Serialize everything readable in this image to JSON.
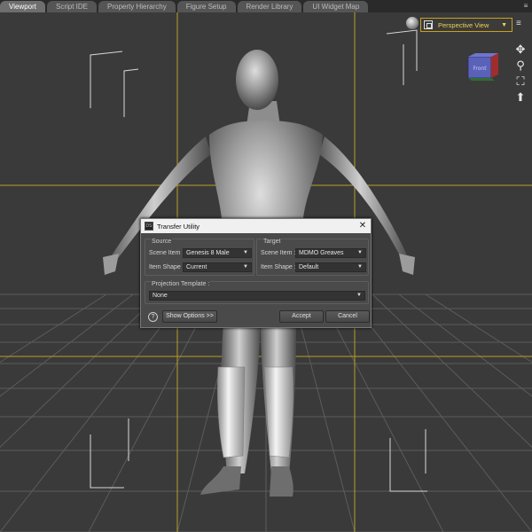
{
  "tabs": [
    {
      "label": "Viewport",
      "active": true
    },
    {
      "label": "Script IDE",
      "active": false
    },
    {
      "label": "Property Hierarchy",
      "active": false
    },
    {
      "label": "Figure Setup",
      "active": false
    },
    {
      "label": "Render Library",
      "active": false
    },
    {
      "label": "UI Widget Map",
      "active": false
    }
  ],
  "tab_menu_icon": "panel-menu-icon",
  "view_controls": {
    "view_selector": "Perspective View",
    "view_selector_icon": "camera-frame-icon",
    "lamp_icon": "lamp-icon",
    "viewcube_label": "Front",
    "nav_icons": [
      "pan-icon",
      "zoom-icon",
      "frame-icon",
      "orbit-icon"
    ]
  },
  "dialog": {
    "title": "Transfer Utility",
    "close_glyph": "✕",
    "source": {
      "label": "Source",
      "scene_item_label": "Scene Item :",
      "scene_item_value": "Genesis 8 Male",
      "item_shape_label": "Item Shape :",
      "item_shape_value": "Current"
    },
    "target": {
      "label": "Target",
      "scene_item_label": "Scene Item :",
      "scene_item_value": "MDMO Greaves",
      "item_shape_label": "Item Shape :",
      "item_shape_value": "Default"
    },
    "projection": {
      "label": "Projection Template :",
      "value": "None"
    },
    "help_glyph": "?",
    "show_options_label": "Show Options >>",
    "accept_label": "Accept",
    "cancel_label": "Cancel"
  },
  "colors": {
    "viewport_bg": "#3a3a3a",
    "guide_yellow": "#b8a020",
    "grid_line": "#5a5a5a",
    "accent": "#c9a21c"
  }
}
